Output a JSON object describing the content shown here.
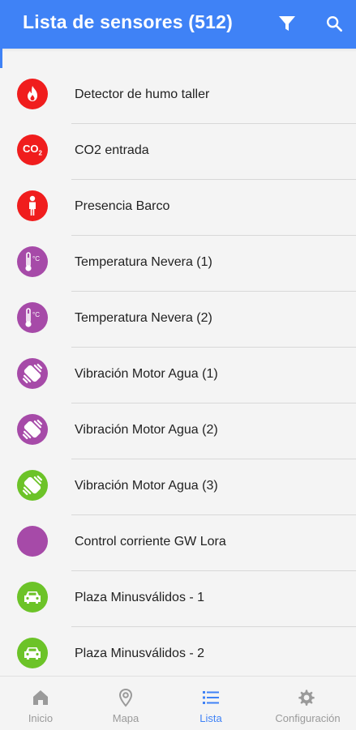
{
  "header": {
    "title": "Lista de sensores (512)",
    "filter_icon": "filter-icon",
    "search_icon": "search-icon"
  },
  "colors": {
    "primary": "#3f82f6",
    "red": "#f01d1d",
    "purple": "#a64aa8",
    "green": "#6cc328"
  },
  "sensors": [
    {
      "label": "Detector de humo taller",
      "icon": "fire-icon",
      "color": "#f01d1d"
    },
    {
      "label": "CO2 entrada",
      "icon": "co2-icon",
      "color": "#f01d1d"
    },
    {
      "label": "Presencia Barco",
      "icon": "person-icon",
      "color": "#f01d1d"
    },
    {
      "label": "Temperatura Nevera (1)",
      "icon": "thermometer-icon",
      "color": "#a64aa8"
    },
    {
      "label": "Temperatura Nevera (2)",
      "icon": "thermometer-icon",
      "color": "#a64aa8"
    },
    {
      "label": "Vibración Motor Agua (1)",
      "icon": "vibration-icon",
      "color": "#a64aa8"
    },
    {
      "label": "Vibración Motor Agua (2)",
      "icon": "vibration-icon",
      "color": "#a64aa8"
    },
    {
      "label": "Vibración Motor Agua (3)",
      "icon": "vibration-icon",
      "color": "#6cc328"
    },
    {
      "label": "Control corriente GW Lora",
      "icon": "",
      "color": "#a64aa8"
    },
    {
      "label": "Plaza Minusválidos - 1",
      "icon": "car-icon",
      "color": "#6cc328"
    },
    {
      "label": "Plaza Minusválidos - 2",
      "icon": "car-icon",
      "color": "#6cc328"
    }
  ],
  "co2_text": "CO",
  "co2_sub": "2",
  "temp_unit": "°C",
  "nav": [
    {
      "label": "Inicio",
      "icon": "home-icon",
      "active": false
    },
    {
      "label": "Mapa",
      "icon": "map-pin-icon",
      "active": false
    },
    {
      "label": "Lista",
      "icon": "list-icon",
      "active": true
    },
    {
      "label": "Configuración",
      "icon": "gear-icon",
      "active": false
    }
  ]
}
